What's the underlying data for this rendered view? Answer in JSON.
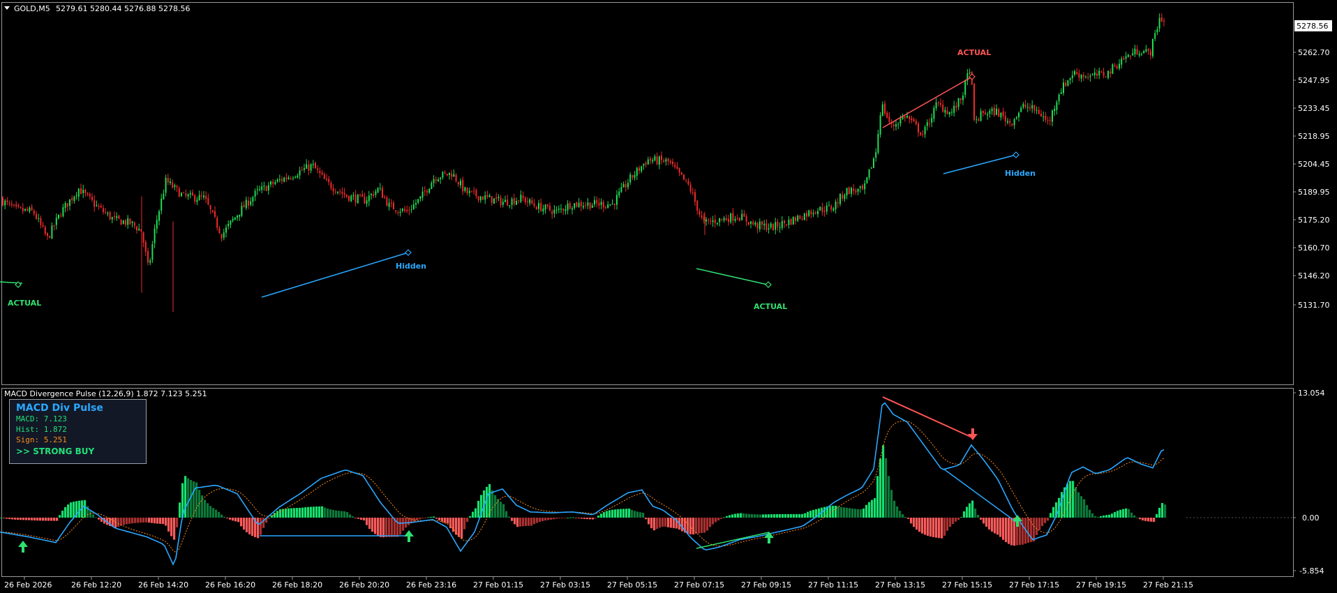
{
  "main_header": {
    "symbol": "GOLD,M5",
    "ohlc": "5279.61 5280.44 5276.88 5278.56"
  },
  "price_axis": {
    "ticks": [
      "5262.70",
      "5247.95",
      "5233.45",
      "5218.95",
      "5204.45",
      "5189.95",
      "5175.20",
      "5160.70",
      "5146.20",
      "5131.70"
    ],
    "current_price": "5278.56"
  },
  "price_series": {
    "start": 5187,
    "knots": [
      [
        0,
        5187
      ],
      [
        25,
        5181
      ],
      [
        50,
        5180
      ],
      [
        70,
        5166
      ],
      [
        90,
        5180
      ],
      [
        115,
        5192
      ],
      [
        140,
        5183
      ],
      [
        165,
        5176
      ],
      [
        190,
        5174
      ],
      [
        205,
        5170
      ],
      [
        215,
        5150
      ],
      [
        225,
        5173
      ],
      [
        240,
        5196
      ],
      [
        265,
        5188
      ],
      [
        295,
        5187
      ],
      [
        320,
        5168
      ],
      [
        345,
        5180
      ],
      [
        370,
        5190
      ],
      [
        395,
        5195
      ],
      [
        420,
        5199
      ],
      [
        450,
        5204
      ],
      [
        470,
        5195
      ],
      [
        500,
        5188
      ],
      [
        525,
        5186
      ],
      [
        545,
        5192
      ],
      [
        560,
        5183
      ],
      [
        585,
        5180
      ],
      [
        605,
        5187
      ],
      [
        625,
        5198
      ],
      [
        650,
        5200
      ],
      [
        670,
        5190
      ],
      [
        700,
        5187
      ],
      [
        725,
        5185
      ],
      [
        750,
        5187
      ],
      [
        770,
        5183
      ],
      [
        800,
        5180
      ],
      [
        820,
        5184
      ],
      [
        850,
        5184
      ],
      [
        880,
        5184
      ],
      [
        905,
        5197
      ],
      [
        930,
        5207
      ],
      [
        960,
        5206
      ],
      [
        990,
        5193
      ],
      [
        1010,
        5174
      ],
      [
        1035,
        5176
      ],
      [
        1060,
        5178
      ],
      [
        1085,
        5173
      ],
      [
        1110,
        5172
      ],
      [
        1140,
        5176
      ],
      [
        1170,
        5181
      ],
      [
        1195,
        5182
      ],
      [
        1215,
        5191
      ],
      [
        1240,
        5191
      ],
      [
        1258,
        5212
      ],
      [
        1265,
        5236
      ],
      [
        1280,
        5224
      ],
      [
        1300,
        5230
      ],
      [
        1325,
        5220
      ],
      [
        1345,
        5236
      ],
      [
        1365,
        5231
      ],
      [
        1380,
        5239
      ],
      [
        1393,
        5256
      ],
      [
        1398,
        5226
      ],
      [
        1410,
        5231
      ],
      [
        1430,
        5232
      ],
      [
        1450,
        5226
      ],
      [
        1470,
        5235
      ],
      [
        1490,
        5232
      ],
      [
        1505,
        5226
      ],
      [
        1520,
        5242
      ],
      [
        1540,
        5252
      ],
      [
        1565,
        5250
      ],
      [
        1590,
        5252
      ],
      [
        1610,
        5259
      ],
      [
        1635,
        5264
      ],
      [
        1650,
        5262
      ],
      [
        1665,
        5282
      ],
      [
        1668,
        5279
      ]
    ]
  },
  "macd_series": {
    "knots": [
      [
        0,
        -1.5
      ],
      [
        40,
        -2.0
      ],
      [
        80,
        -2.6
      ],
      [
        100,
        -0.5
      ],
      [
        120,
        1.2
      ],
      [
        140,
        0.3
      ],
      [
        165,
        -1.1
      ],
      [
        185,
        -1.5
      ],
      [
        210,
        -2.0
      ],
      [
        235,
        -2.8
      ],
      [
        250,
        -5.2
      ],
      [
        262,
        0.5
      ],
      [
        280,
        3.1
      ],
      [
        310,
        3.4
      ],
      [
        340,
        2.5
      ],
      [
        370,
        -0.8
      ],
      [
        400,
        1.1
      ],
      [
        430,
        2.5
      ],
      [
        460,
        4.1
      ],
      [
        495,
        5.0
      ],
      [
        520,
        4.4
      ],
      [
        545,
        1.6
      ],
      [
        570,
        -0.6
      ],
      [
        590,
        -0.5
      ],
      [
        620,
        -0.2
      ],
      [
        640,
        -1.0
      ],
      [
        660,
        -3.5
      ],
      [
        680,
        -1.5
      ],
      [
        700,
        2.5
      ],
      [
        720,
        3.0
      ],
      [
        740,
        1.3
      ],
      [
        760,
        0.6
      ],
      [
        790,
        0.5
      ],
      [
        820,
        0.6
      ],
      [
        850,
        0.3
      ],
      [
        870,
        1.3
      ],
      [
        900,
        2.6
      ],
      [
        920,
        2.9
      ],
      [
        935,
        1.2
      ],
      [
        950,
        0.8
      ],
      [
        970,
        -0.3
      ],
      [
        990,
        -2.1
      ],
      [
        1010,
        -3.4
      ],
      [
        1030,
        -3.1
      ],
      [
        1060,
        -2.3
      ],
      [
        1090,
        -1.9
      ],
      [
        1120,
        -1.4
      ],
      [
        1150,
        -0.9
      ],
      [
        1170,
        0.1
      ],
      [
        1195,
        1.6
      ],
      [
        1215,
        2.4
      ],
      [
        1235,
        3.1
      ],
      [
        1252,
        5.1
      ],
      [
        1265,
        12.3
      ],
      [
        1280,
        10.8
      ],
      [
        1300,
        10.0
      ],
      [
        1325,
        7.5
      ],
      [
        1350,
        5.0
      ],
      [
        1375,
        5.5
      ],
      [
        1392,
        7.6
      ],
      [
        1410,
        6.0
      ],
      [
        1430,
        4.0
      ],
      [
        1450,
        1.0
      ],
      [
        1465,
        -0.8
      ],
      [
        1480,
        -2.3
      ],
      [
        1500,
        -1.8
      ],
      [
        1515,
        0.4
      ],
      [
        1535,
        4.7
      ],
      [
        1552,
        5.3
      ],
      [
        1570,
        4.6
      ],
      [
        1590,
        5.0
      ],
      [
        1615,
        6.3
      ],
      [
        1635,
        5.6
      ],
      [
        1652,
        5.2
      ],
      [
        1665,
        7.1
      ]
    ]
  },
  "time_axis": {
    "labels": [
      "26 Feb 2026",
      "26 Feb 12:20",
      "26 Feb 14:20",
      "26 Feb 16:20",
      "26 Feb 18:20",
      "26 Feb 20:20",
      "26 Feb 23:16",
      "27 Feb 01:15",
      "27 Feb 03:15",
      "27 Feb 05:15",
      "27 Feb 07:15",
      "27 Feb 09:15",
      "27 Feb 11:15",
      "27 Feb 13:15",
      "27 Feb 15:15",
      "27 Feb 17:15",
      "27 Feb 19:15",
      "27 Feb 21:15"
    ]
  },
  "divergence_labels": {
    "actual_1": "ACTUAL",
    "hidden_1": "Hidden",
    "actual_2": "ACTUAL",
    "actual_3": "ACTUAL",
    "hidden_2": "Hidden"
  },
  "indicator": {
    "header": "MACD Divergence Pulse (12,26,9) 1.872 7.123 5.251",
    "axis_top": "13.054",
    "axis_zero": "0.00",
    "axis_bottom": "-5.854",
    "box_title": "MACD Div Pulse",
    "macd_line": "MACD: 7.123",
    "hist_line": "Hist: 1.872",
    "sign_line": "Sign: 5.251",
    "signal_text": ">> STRONG BUY"
  },
  "colors": {
    "bull_candle": "#22dd55",
    "bear_candle": "#ee2a2a",
    "macd_line": "#2aa8ff",
    "signal_line": "#ff8c1a",
    "hist_pos_strong": "#14e06e",
    "hist_pos_weak": "#0c7a3a",
    "hist_neg_strong": "#ff5a5a",
    "hist_neg_weak": "#a83030",
    "bull_div": "#30e070",
    "bear_div": "#ff5555",
    "hidden_div": "#2aa8ff"
  }
}
